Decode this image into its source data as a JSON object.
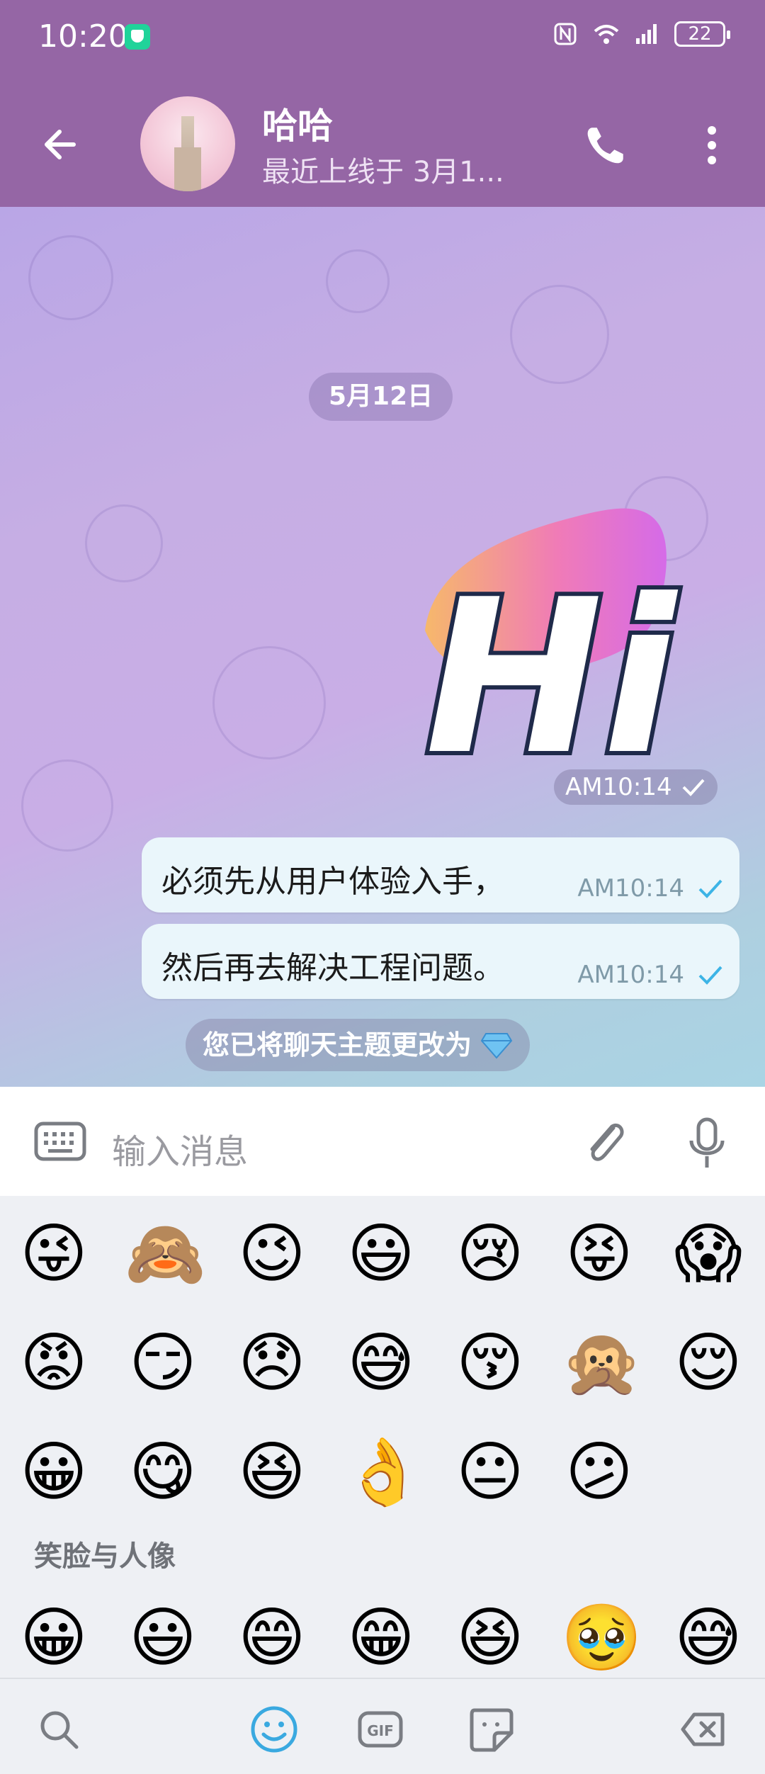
{
  "status": {
    "time": "10:20",
    "battery": "22"
  },
  "header": {
    "name": "哈哈",
    "last_seen": "最近上线于 3月1..."
  },
  "chat": {
    "date_chip": "5月12日",
    "sticker": {
      "text": "Hi",
      "time": "AM10:14"
    },
    "messages": [
      {
        "text": "必须先从用户体验入手，",
        "time": "AM10:14"
      },
      {
        "text": "然后再去解决工程问题。",
        "time": "AM10:14"
      }
    ],
    "system_message": "您已将聊天主题更改为"
  },
  "input": {
    "placeholder": "输入消息"
  },
  "emoji": {
    "recent_rows": [
      [
        "😜",
        "🙈",
        "😉",
        "😃",
        "😢",
        "😝",
        "😱"
      ],
      [
        "😡",
        "😏",
        "😞",
        "😅",
        "😚",
        "🙊",
        "😌"
      ],
      [
        "😀",
        "😋",
        "😆",
        "👌",
        "😐",
        "😕"
      ]
    ],
    "section_title": "笑脸与人像",
    "section_row": [
      "😀",
      "😃",
      "😄",
      "😁",
      "😆",
      "🥹",
      "😅"
    ]
  },
  "colors": {
    "header": "#9566a5",
    "bubble": "#eaf6fb",
    "check": "#3db4e6"
  }
}
